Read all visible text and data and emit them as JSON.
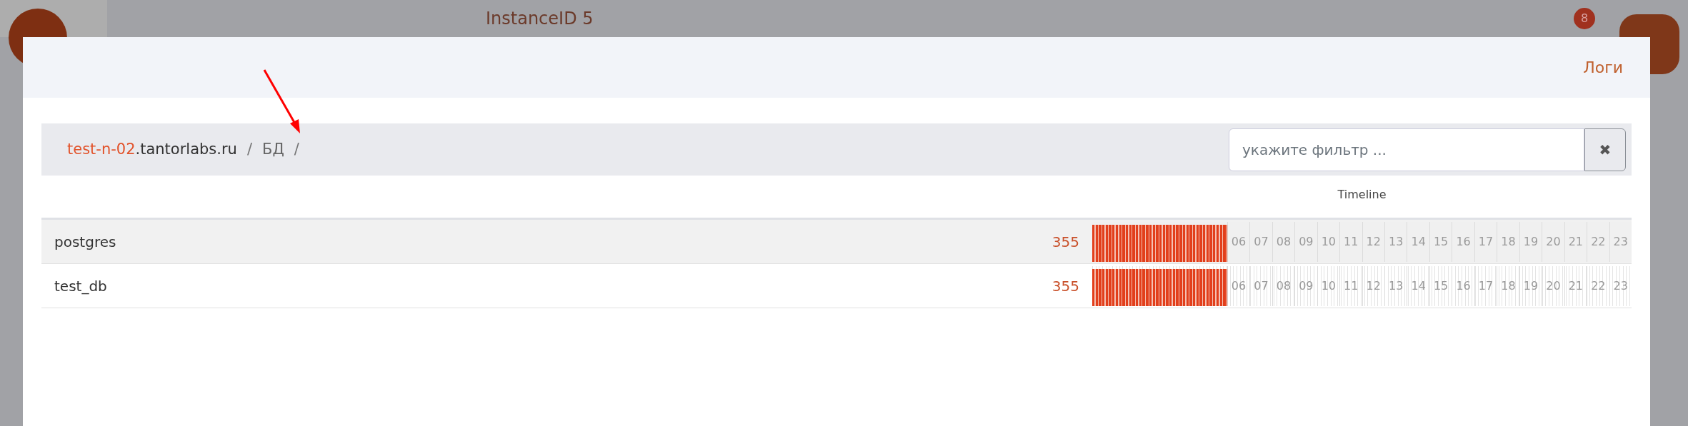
{
  "backdrop": {
    "title": "InstanceID 5",
    "badge": "8"
  },
  "modal": {
    "header_link": "Логи",
    "breadcrumb": {
      "host_highlight": "test-n-02",
      "host_rest": ".tantorlabs.ru",
      "separator_1": "/",
      "section": "БД",
      "separator_2": "/"
    },
    "filter": {
      "placeholder": "укажите фильтр ...",
      "clear_button": "✖"
    },
    "table": {
      "timeline_heading": "Timeline",
      "rows": [
        {
          "name": "postgres",
          "count": "355",
          "selected": true,
          "timeline": {
            "level": 0.25,
            "hours": [
              "06",
              "07",
              "08",
              "09",
              "10",
              "11",
              "12",
              "13",
              "14",
              "15",
              "16",
              "17",
              "18",
              "19",
              "20",
              "21",
              "22",
              "23"
            ]
          }
        },
        {
          "name": "test_db",
          "count": "355",
          "selected": false,
          "timeline": {
            "level": 0.25,
            "hours": [
              "06",
              "07",
              "08",
              "09",
              "10",
              "11",
              "12",
              "13",
              "14",
              "15",
              "16",
              "17",
              "18",
              "19",
              "20",
              "21",
              "22",
              "23"
            ]
          }
        }
      ]
    }
  }
}
